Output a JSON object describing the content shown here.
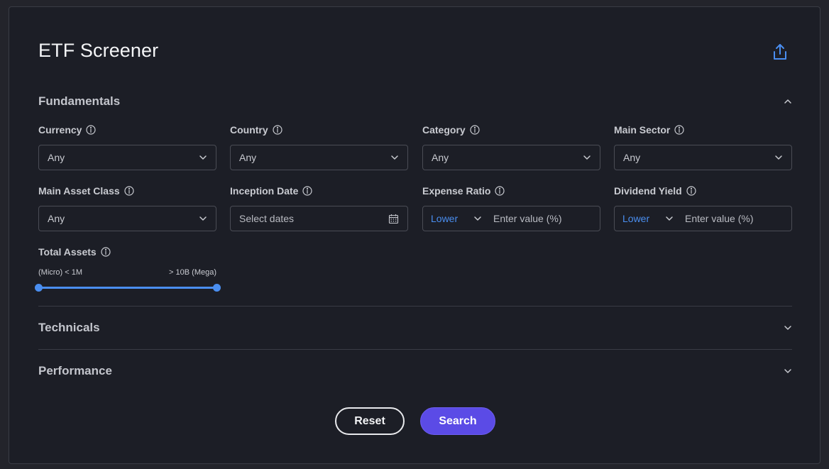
{
  "page": {
    "title": "ETF Screener"
  },
  "icons": {
    "share": "share-upload-icon",
    "info": "info-icon",
    "chevron": "chevron-icon",
    "calendar": "calendar-icon"
  },
  "colors": {
    "accent": "#4a8ef0",
    "primary_button": "#5b4be6",
    "panel": "#1c1e26"
  },
  "sections": {
    "fundamentals": {
      "label": "Fundamentals",
      "expanded": true
    },
    "technicals": {
      "label": "Technicals",
      "expanded": false
    },
    "performance": {
      "label": "Performance",
      "expanded": false
    }
  },
  "fields": {
    "currency": {
      "label": "Currency",
      "value": "Any"
    },
    "country": {
      "label": "Country",
      "value": "Any"
    },
    "category": {
      "label": "Category",
      "value": "Any"
    },
    "main_sector": {
      "label": "Main Sector",
      "value": "Any"
    },
    "main_asset_class": {
      "label": "Main Asset Class",
      "value": "Any"
    },
    "inception_date": {
      "label": "Inception Date",
      "placeholder": "Select dates"
    },
    "expense_ratio": {
      "label": "Expense Ratio",
      "direction": "Lower",
      "placeholder": "Enter value (%)"
    },
    "dividend_yield": {
      "label": "Dividend Yield",
      "direction": "Lower",
      "placeholder": "Enter value (%)"
    },
    "total_assets": {
      "label": "Total Assets",
      "min_label": "(Micro) < 1M",
      "max_label": "> 10B (Mega)",
      "range_start_fraction": 0,
      "range_end_fraction": 1
    }
  },
  "buttons": {
    "reset": "Reset",
    "search": "Search"
  }
}
